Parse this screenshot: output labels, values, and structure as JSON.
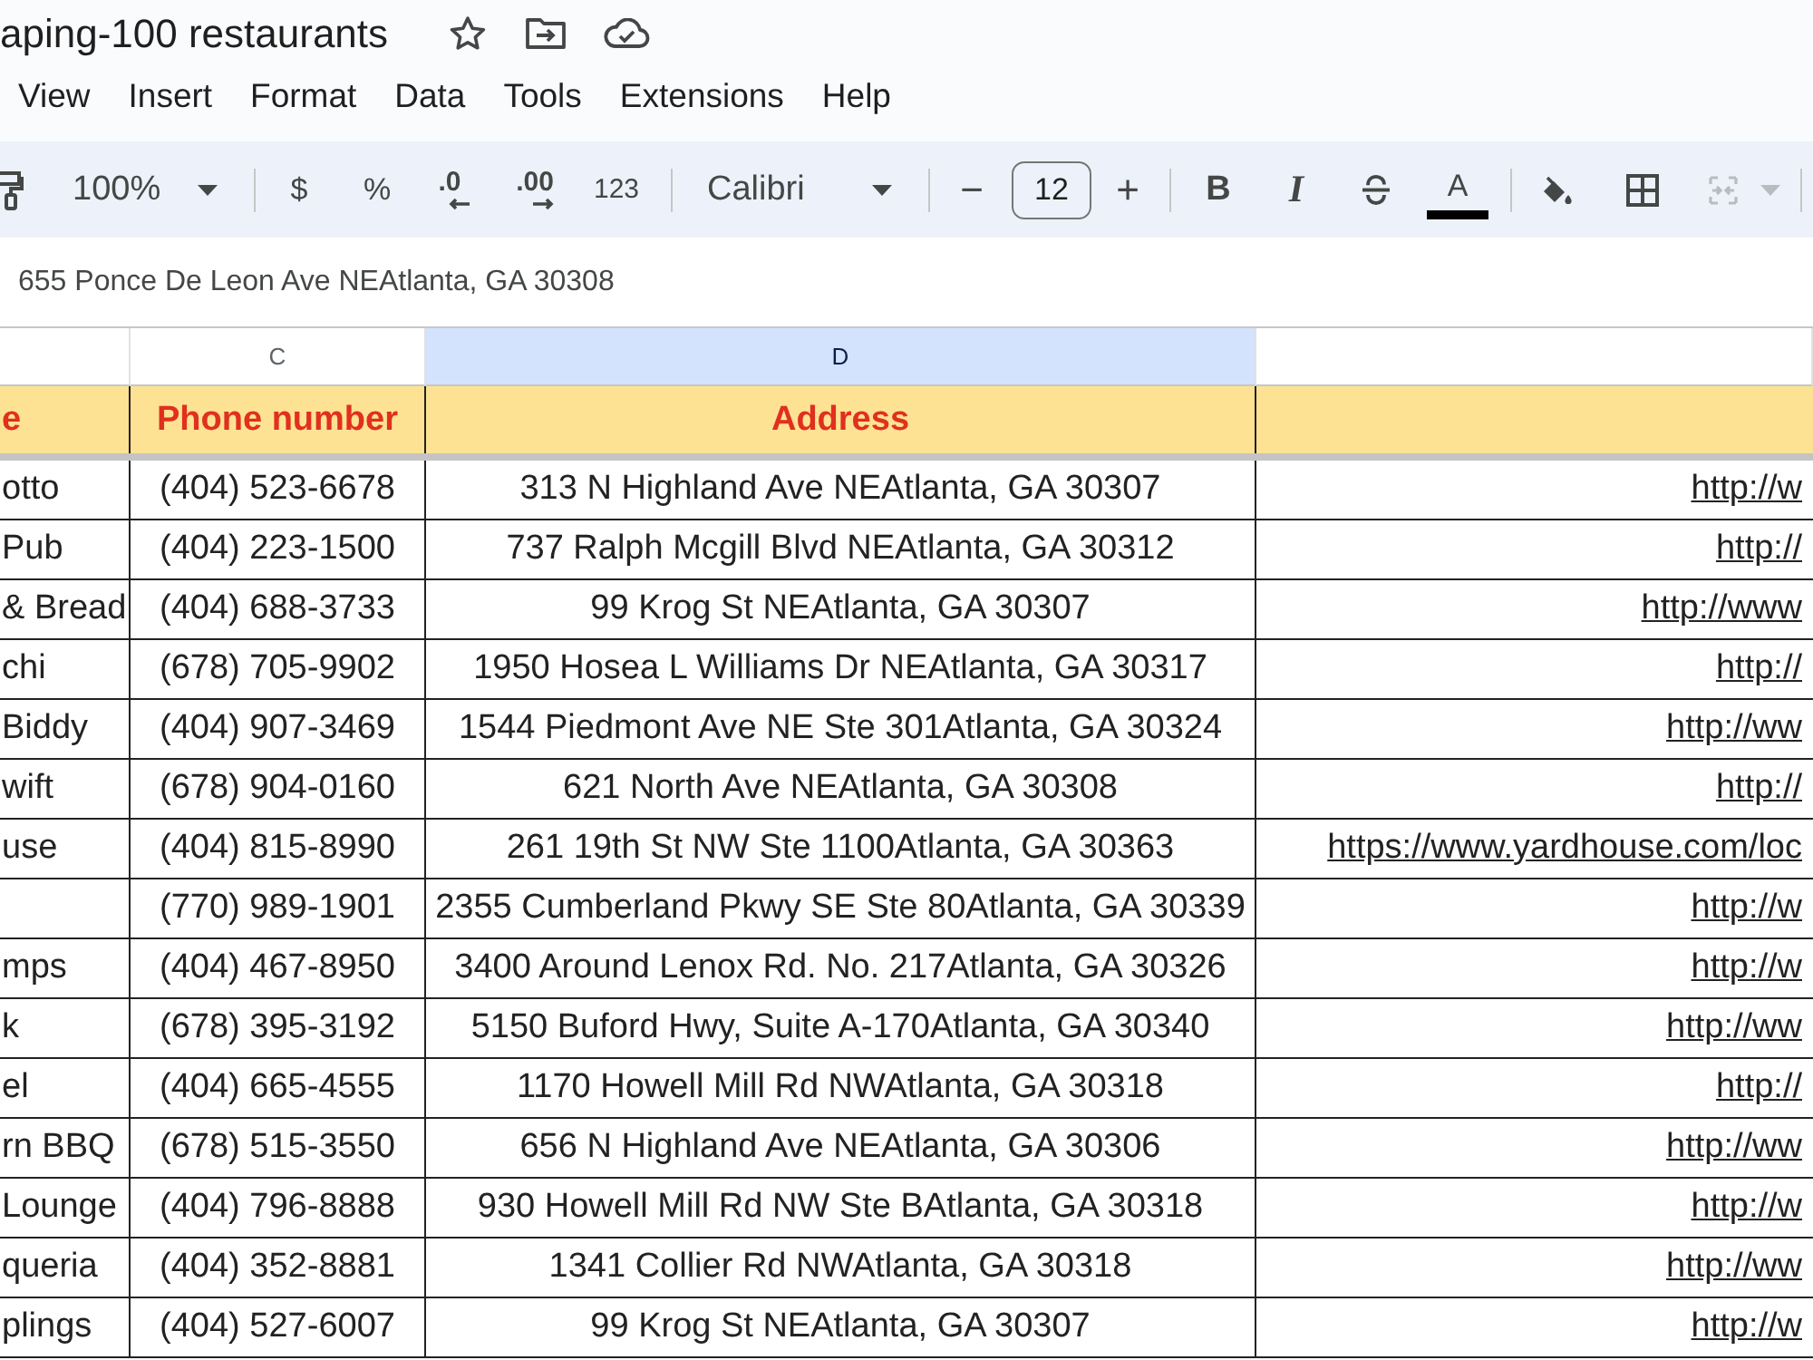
{
  "document": {
    "title": "aping-100 restaurants"
  },
  "menu_bar": {
    "items": [
      "View",
      "Insert",
      "Format",
      "Data",
      "Tools",
      "Extensions",
      "Help"
    ]
  },
  "toolbar": {
    "zoom": "100%",
    "number_formats": [
      {
        "kind": "currency",
        "label": "$"
      },
      {
        "kind": "percent",
        "label": "%"
      },
      {
        "kind": "decrease_decimals",
        "label": ".0"
      },
      {
        "kind": "increase_decimals",
        "label": ".00"
      },
      {
        "kind": "more_formats",
        "label": "123"
      }
    ],
    "font": "Calibri",
    "font_size": {
      "decrease": "−",
      "value": "12",
      "increase": "+"
    },
    "text_styles": [
      {
        "kind": "bold",
        "label": "B"
      },
      {
        "kind": "italic",
        "label": "I"
      },
      {
        "kind": "strikethrough"
      },
      {
        "kind": "text_color",
        "label": "A"
      }
    ],
    "merge_disabled": true
  },
  "formula_bar": {
    "value": "655 Ponce De Leon Ave NEAtlanta, GA 30308"
  },
  "sheet": {
    "columns": [
      {
        "selected": false
      },
      {
        "letter": "C",
        "selected": false
      },
      {
        "letter": "D",
        "selected": true
      },
      {
        "selected": false
      }
    ],
    "header_row": {
      "column_b": "e",
      "phone_number": "Phone number",
      "address": "Address"
    },
    "rows": [
      {
        "column_b": "otto",
        "phone_number": "(404) 523-6678",
        "address": "313 N Highland Ave NEAtlanta, GA 30307",
        "column_e": "http://w"
      },
      {
        "column_b": "Pub",
        "phone_number": "(404) 223-1500",
        "address": "737 Ralph Mcgill Blvd NEAtlanta, GA 30312",
        "column_e": "http://"
      },
      {
        "column_b": "& Bread",
        "phone_number": "(404) 688-3733",
        "address": "99 Krog St NEAtlanta, GA 30307",
        "column_e": "http://www"
      },
      {
        "column_b": "chi",
        "phone_number": "(678) 705-9902",
        "address": "1950 Hosea L Williams Dr NEAtlanta, GA 30317",
        "column_e": "http://"
      },
      {
        "column_b": "Biddy",
        "phone_number": "(404) 907-3469",
        "address": "1544 Piedmont Ave NE Ste 301Atlanta, GA 30324",
        "column_e": "http://ww"
      },
      {
        "column_b": "wift",
        "phone_number": "(678) 904-0160",
        "address": "621 North Ave NEAtlanta, GA 30308",
        "column_e": "http://"
      },
      {
        "column_b": "use",
        "phone_number": "(404) 815-8990",
        "address": "261 19th St NW Ste 1100Atlanta, GA 30363",
        "column_e": "https://www.yardhouse.com/loc"
      },
      {
        "phone_number": "(770) 989-1901",
        "address": "2355 Cumberland Pkwy SE Ste 80Atlanta, GA 30339",
        "column_e": "http://w"
      },
      {
        "column_b": "mps",
        "phone_number": "(404) 467-8950",
        "address": "3400 Around Lenox Rd. No. 217Atlanta, GA 30326",
        "column_e": "http://w"
      },
      {
        "column_b": "k",
        "phone_number": "(678) 395-3192",
        "address": "5150 Buford Hwy, Suite A-170Atlanta, GA 30340",
        "column_e": "http://ww"
      },
      {
        "column_b": "el",
        "phone_number": "(404) 665-4555",
        "address": "1170 Howell Mill Rd NWAtlanta, GA 30318",
        "column_e": "http://"
      },
      {
        "column_b": "rn BBQ",
        "phone_number": "(678) 515-3550",
        "address": "656 N Highland Ave NEAtlanta, GA 30306",
        "column_e": "http://ww"
      },
      {
        "column_b": "Lounge",
        "phone_number": "(404) 796-8888",
        "address": "930 Howell Mill Rd NW Ste BAtlanta, GA 30318",
        "column_e": "http://w"
      },
      {
        "column_b": "queria",
        "phone_number": "(404) 352-8881",
        "address": "1341 Collier Rd NWAtlanta, GA 30318",
        "column_e": "http://ww"
      },
      {
        "column_b": "plings",
        "phone_number": "(404) 527-6007",
        "address": "99 Krog St NEAtlanta, GA 30307",
        "column_e": "http://w"
      }
    ]
  }
}
